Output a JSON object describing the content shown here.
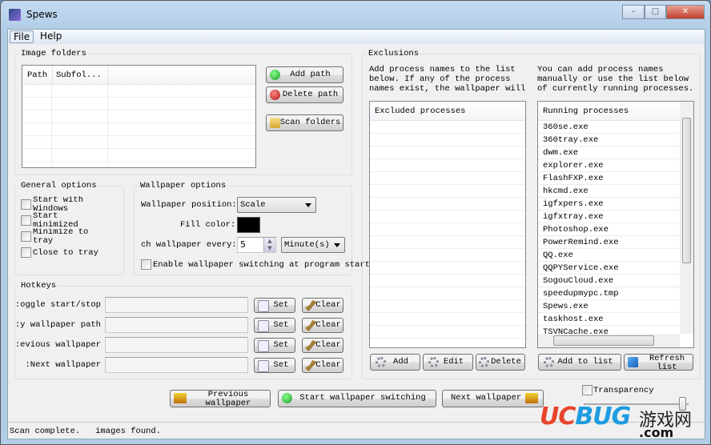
{
  "window": {
    "title": "Spews",
    "controls": {
      "minimize": "–",
      "maximize": "□",
      "close": "✕"
    }
  },
  "menu": [
    {
      "label": "File"
    },
    {
      "label": "Help"
    }
  ],
  "image_folders": {
    "legend": "Image folders",
    "columns": [
      "Path",
      "Subfol..."
    ],
    "add_path": "Add path",
    "delete_path": "Delete path",
    "scan_folders": "Scan folders"
  },
  "general_options": {
    "legend": "General options",
    "checkboxes": [
      {
        "label": "Start with Windows",
        "checked": false
      },
      {
        "label": "Start minimized",
        "checked": false
      },
      {
        "label": "Minimize to tray",
        "checked": false
      },
      {
        "label": "Close to tray",
        "checked": false
      }
    ]
  },
  "wallpaper_options": {
    "legend": "Wallpaper options",
    "position_label": "Wallpaper position:",
    "position_value": "Scale",
    "fill_label": "Fill color:",
    "fill_color": "#000000",
    "switch_label": "ch wallpaper every:",
    "switch_value": "5",
    "unit_value": "Minute(s)",
    "enable_startup": "Enable wallpaper switching at program startup"
  },
  "hotkeys": {
    "legend": "Hotkeys",
    "set_label": "Set",
    "clear_label": "Clear",
    "rows": [
      {
        "label": "oggle start/stop:",
        "value": ""
      },
      {
        "label": "y wallpaper path:",
        "value": ""
      },
      {
        "label": "evious wallpaper:",
        "value": ""
      },
      {
        "label": "Next wallpaper:",
        "value": ""
      }
    ]
  },
  "exclusions": {
    "legend": "Exclusions",
    "left_text": "Add process names to the list below.  If any of the process names exist, the wallpaper will not be changed.",
    "right_text": "You can add process names manually or use the list below of currently running processes.",
    "excluded_header": "Excluded processes",
    "running_header": "Running processes",
    "running": [
      "360se.exe",
      "360tray.exe",
      "dwm.exe",
      "explorer.exe",
      "FlashFXP.exe",
      "hkcmd.exe",
      "igfxpers.exe",
      "igfxtray.exe",
      "Photoshop.exe",
      "PowerRemind.exe",
      "QQ.exe",
      "QQPYService.exe",
      "SogouCloud.exe",
      "speedupmypc.tmp",
      "Spews.exe",
      "taskhost.exe",
      "TSVNCache.exe"
    ],
    "add": "Add",
    "edit": "Edit",
    "delete": "Delete",
    "add_to_list": "Add to list",
    "refresh_list": "Refresh list"
  },
  "bottom": {
    "previous": "Previous wallpaper",
    "start": "Start wallpaper switching",
    "next": "Next wallpaper",
    "transparency": "Transparency",
    "transparency_checked": false,
    "transparency_level": 0.95
  },
  "status": "Scan complete.   images found.",
  "watermark": {
    "text": "UCBUG",
    "cn": "游戏网",
    "com": ".com"
  },
  "colors": {
    "accent": "#3c7fb1",
    "title_bar": "#b9d1ea",
    "green": "#2db83d",
    "red": "#d52a2a"
  }
}
